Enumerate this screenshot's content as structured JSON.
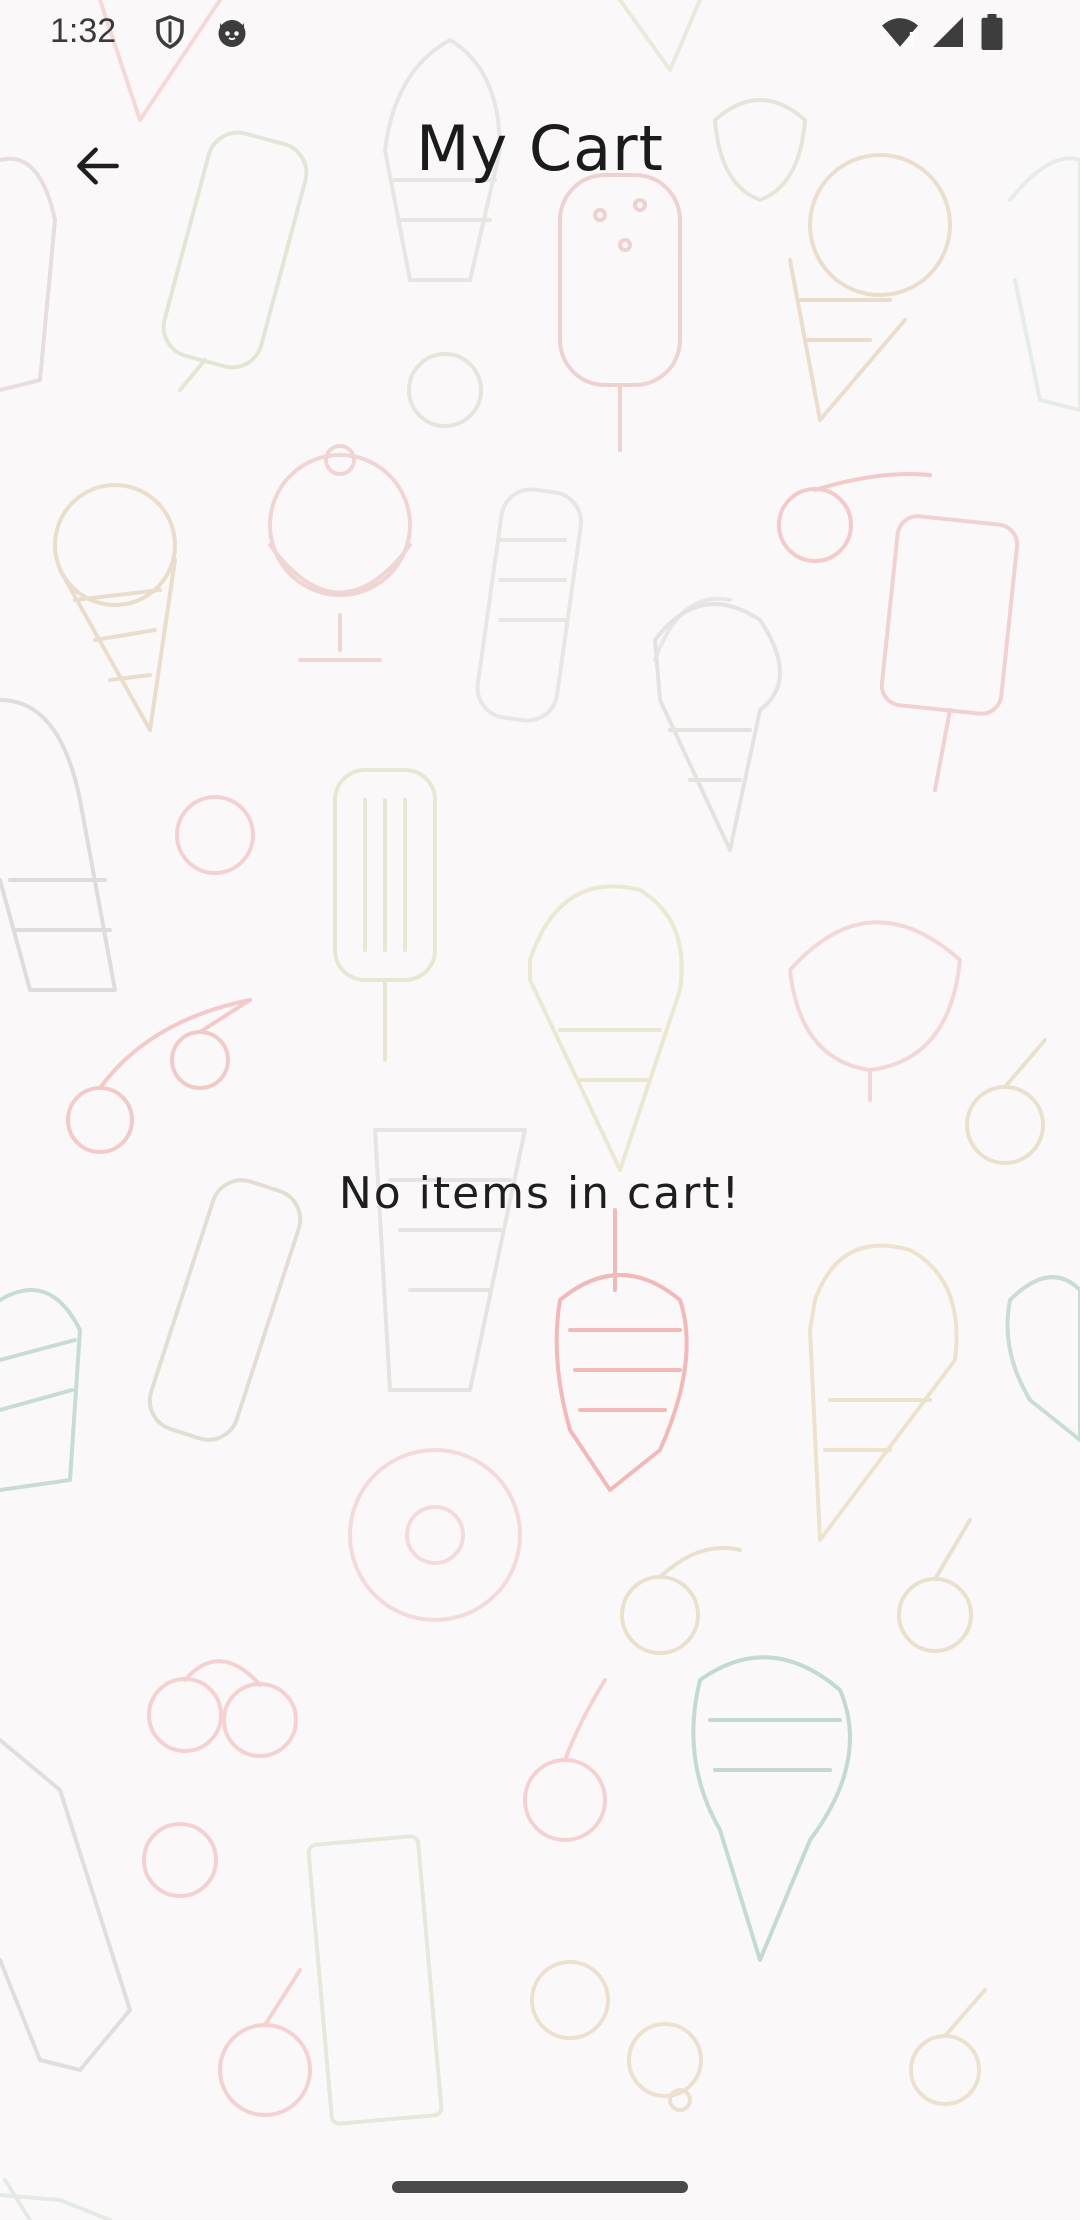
{
  "status_bar": {
    "time": "1:32",
    "left_icons": [
      "shield-icon",
      "cat-icon"
    ],
    "right_icons": [
      "wifi-icon",
      "signal-icon",
      "battery-icon"
    ]
  },
  "header": {
    "back_icon": "arrow-left-icon",
    "title": "My Cart"
  },
  "cart": {
    "empty_message": "No items in cart!"
  },
  "background": {
    "pattern": "ice-cream-doodles",
    "colors": [
      "#e4b8b8",
      "#c9d9c8",
      "#e9d7c4",
      "#b9d5cf",
      "#d9c8c8"
    ]
  }
}
